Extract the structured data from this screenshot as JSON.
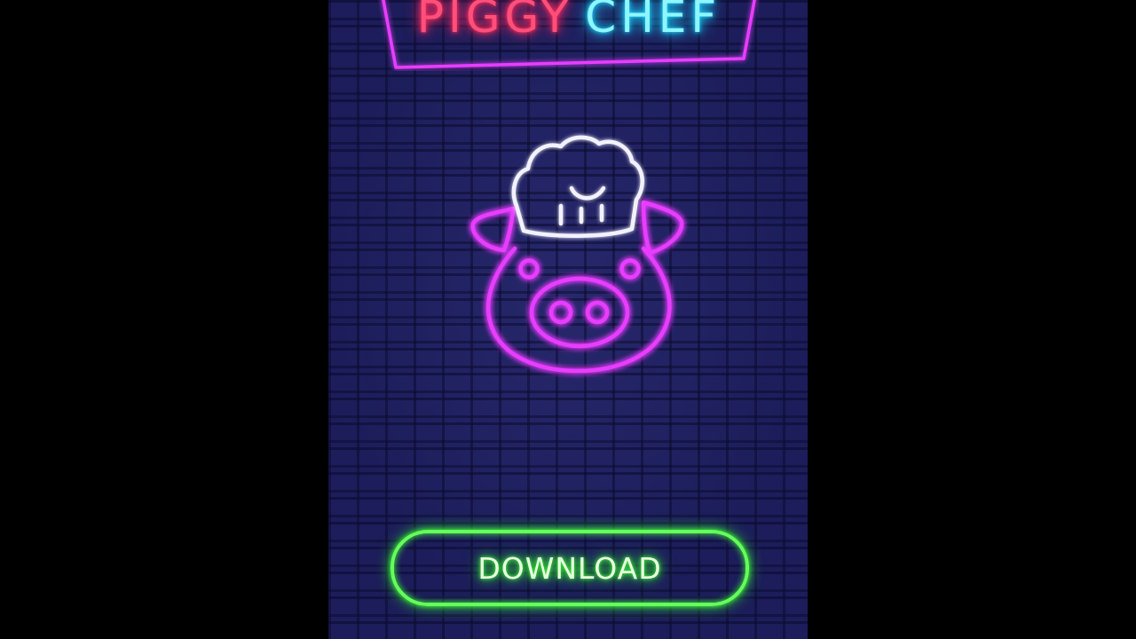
{
  "app": {
    "title_word_1": "PIGGY",
    "title_word_2": "CHEF",
    "logo_icon": "pig-chef-icon",
    "download_label": "DOWNLOAD"
  },
  "colors": {
    "letterbox": "#000000",
    "brick_wall": "#1c1d5a",
    "neon_pink": "#ff2a5c",
    "neon_cyan": "#19d6ff",
    "neon_magenta": "#e83cff",
    "neon_white": "#f2f2ff",
    "neon_green": "#3dff3a"
  }
}
